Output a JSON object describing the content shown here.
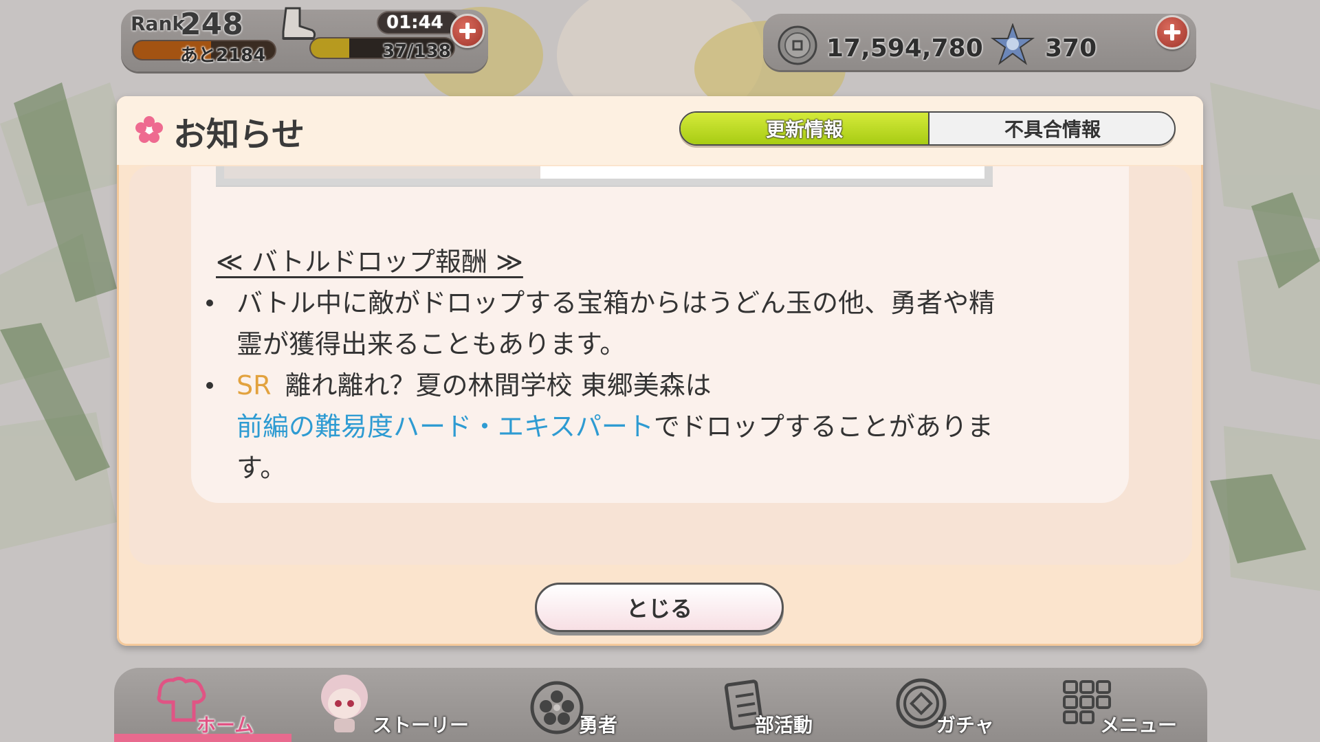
{
  "hud": {
    "rank_label": "Rank",
    "rank_value": "248",
    "exp_remaining": "あと2184",
    "exp_progress": 0.55,
    "stamina_timer": "01:44",
    "stamina_text": "37/138",
    "stamina_progress": 0.27,
    "coins": "17,594,780",
    "gems": "370"
  },
  "dialog": {
    "title": "お知らせ",
    "tabs": [
      {
        "label": "更新情報",
        "active": true
      },
      {
        "label": "不具合情報",
        "active": false
      }
    ],
    "section_heading": "≪ バトルドロップ報酬 ≫",
    "bullet1_line1": "バトル中に敵がドロップする宝箱からはうどん玉の他、勇者や精",
    "bullet1_line2": "霊が獲得出来ることもあります。",
    "bullet2_badge": "SR",
    "bullet2_line1": "離れ離れ？夏の林間学校 東郷美森は",
    "bullet2_link": "前編の難易度ハード・エキスパート",
    "bullet2_line2_rest": "でドロップすることがありま",
    "bullet2_line3": "す。",
    "close_label": "とじる"
  },
  "nav": {
    "items": [
      {
        "label": "ホーム",
        "icon": "home-icon",
        "active": true
      },
      {
        "label": "ストーリー",
        "icon": "story-icon",
        "active": false
      },
      {
        "label": "勇者",
        "icon": "hero-icon",
        "active": false
      },
      {
        "label": "部活動",
        "icon": "club-icon",
        "active": false
      },
      {
        "label": "ガチャ",
        "icon": "gacha-icon",
        "active": false
      },
      {
        "label": "メニュー",
        "icon": "menu-icon",
        "active": false
      }
    ]
  },
  "colors": {
    "accent_tab": "#a8cc14",
    "link": "#2e9bd2",
    "sr_badge": "#e2a23e",
    "home_active": "#e05484"
  }
}
